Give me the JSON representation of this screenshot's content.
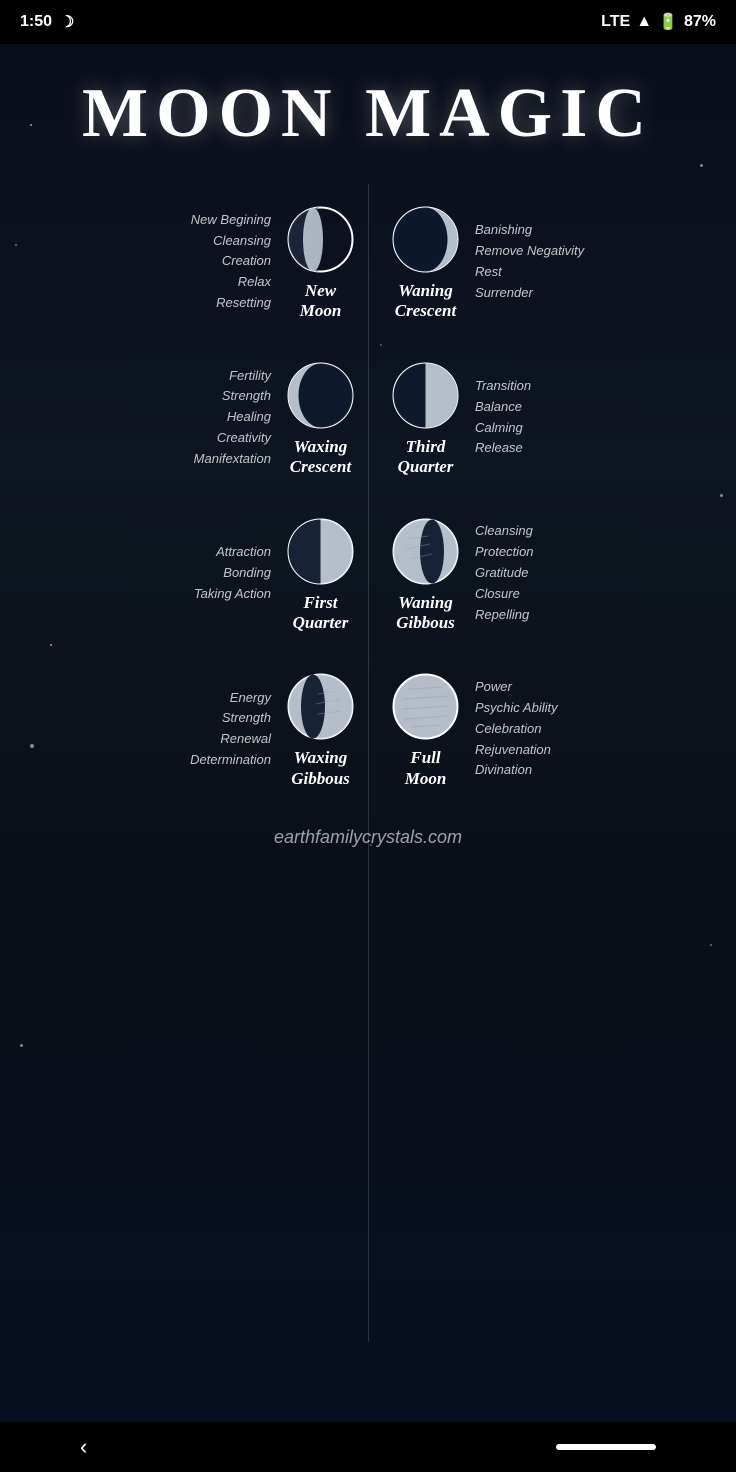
{
  "statusBar": {
    "time": "1:50",
    "moonIcon": "☽",
    "lte": "LTE",
    "battery": "87%"
  },
  "title": "MOON MAGIC",
  "divider": "|",
  "moonPhases": [
    {
      "id": "new-moon",
      "side": "left",
      "label": "New\nMoon",
      "keywords": [
        "New Begining",
        "Cleansing",
        "Creation",
        "Relax",
        "Resetting"
      ],
      "phase": "new"
    },
    {
      "id": "waning-crescent",
      "side": "right",
      "label": "Waning\nCrescent",
      "keywords": [
        "Banishing",
        "Remove Negativity",
        "Rest",
        "Surrender"
      ],
      "phase": "waning-crescent"
    },
    {
      "id": "waxing-crescent",
      "side": "left",
      "label": "Waxing\nCrescent",
      "keywords": [
        "Fertility",
        "Strength",
        "Healing",
        "Creativity",
        "Manifextation"
      ],
      "phase": "waxing-crescent"
    },
    {
      "id": "third-quarter",
      "side": "right",
      "label": "Third\nQuarter",
      "keywords": [
        "Transition",
        "Balance",
        "Calming",
        "Release"
      ],
      "phase": "third-quarter"
    },
    {
      "id": "first-quarter",
      "side": "left",
      "label": "First\nQuarter",
      "keywords": [
        "Attraction",
        "Bonding",
        "Taking Action"
      ],
      "phase": "first-quarter"
    },
    {
      "id": "waning-gibbous",
      "side": "right",
      "label": "Waning\nGibbous",
      "keywords": [
        "Cleansing",
        "Protection",
        "Gratitude",
        "Closure",
        "Repelling"
      ],
      "phase": "waning-gibbous"
    },
    {
      "id": "waxing-gibbous",
      "side": "left",
      "label": "Waxing\nGibbous",
      "keywords": [
        "Energy",
        "Strength",
        "Renewal",
        "Determination"
      ],
      "phase": "waxing-gibbous"
    },
    {
      "id": "full-moon",
      "side": "right",
      "label": "Full\nMoon",
      "keywords": [
        "Power",
        "Psychic Ability",
        "Celebration",
        "Rejuvenation",
        "Divination"
      ],
      "phase": "full"
    }
  ],
  "credit": "earthfamilycrystals.com",
  "nav": {
    "back": "‹"
  }
}
